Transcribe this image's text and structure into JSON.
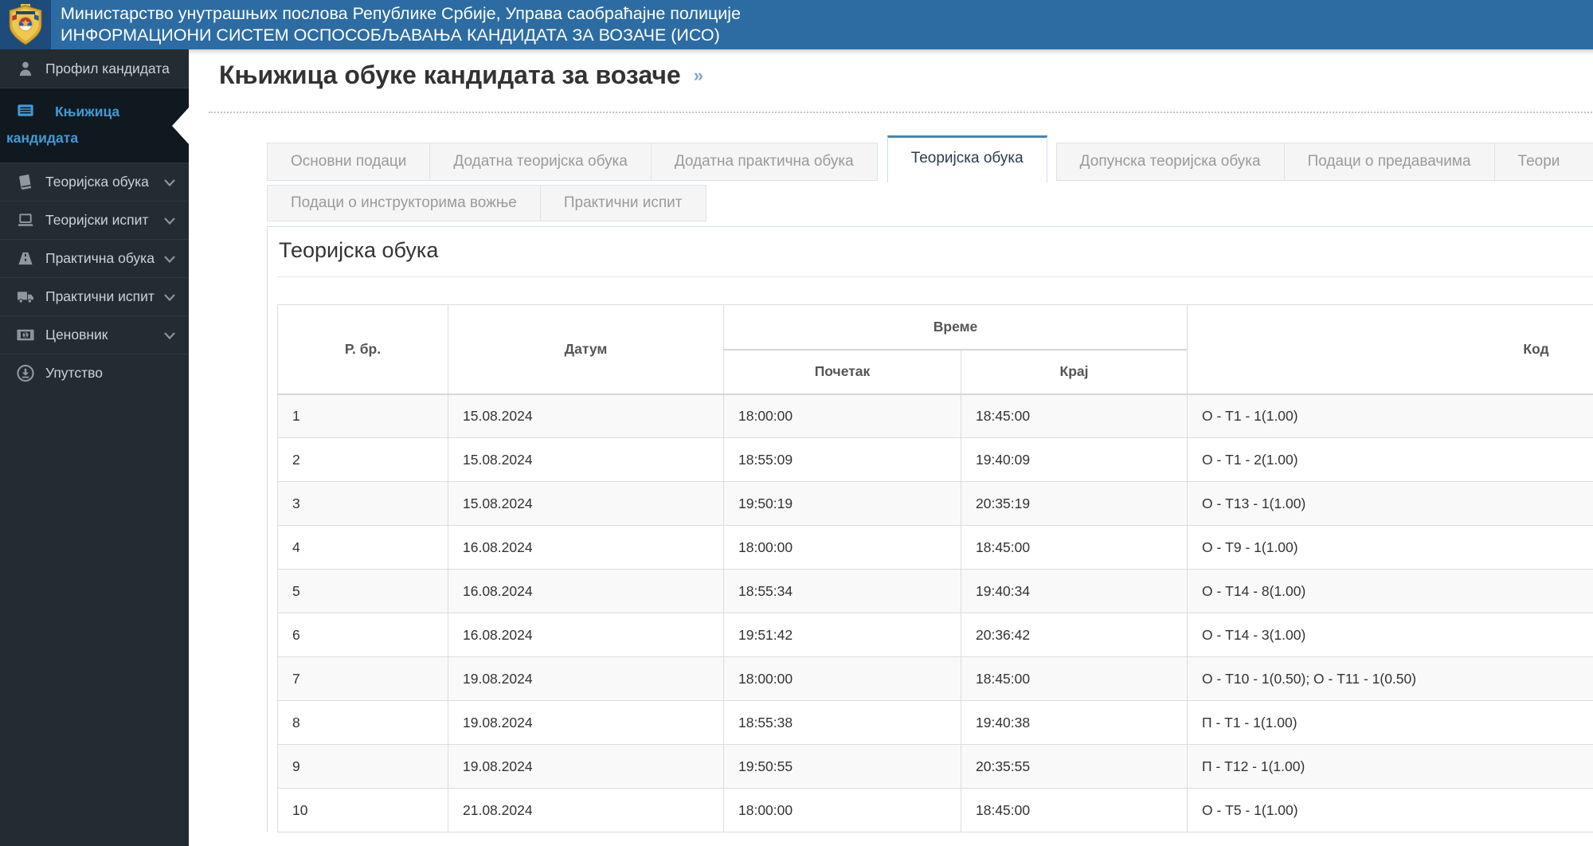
{
  "header": {
    "line1": "Министарство унутрашњих послова Републике Србије, Управа саобраћајне полиције",
    "line2": "ИНФОРМАЦИОНИ СИСТЕМ ОСПОСОБЉАВАЊА КАНДИДАТА ЗА ВОЗАЧЕ (ИСО)"
  },
  "sidebar": {
    "items": [
      {
        "key": "profil-kandidata",
        "label": "Профил кандидата",
        "icon": "user-icon",
        "active": false,
        "chevron": false
      },
      {
        "key": "knjizica-kandidata",
        "label": "Књижица кандидата",
        "icon": "list-icon",
        "active": true,
        "chevron": false
      },
      {
        "key": "teorijska-obuka",
        "label": "Теоријска обука",
        "icon": "book-icon",
        "active": false,
        "chevron": true
      },
      {
        "key": "teorijski-ispit",
        "label": "Теоријски испит",
        "icon": "laptop-icon",
        "active": false,
        "chevron": true
      },
      {
        "key": "prakticna-obuka",
        "label": "Практична обука",
        "icon": "road-icon",
        "active": false,
        "chevron": true
      },
      {
        "key": "prakticni-ispit",
        "label": "Практични испит",
        "icon": "truck-icon",
        "active": false,
        "chevron": true
      },
      {
        "key": "cenovnik",
        "label": "Ценовник",
        "icon": "banknote-icon",
        "active": false,
        "chevron": true
      },
      {
        "key": "uputstvo",
        "label": "Упутство",
        "icon": "download-icon",
        "active": false,
        "chevron": false
      }
    ]
  },
  "page": {
    "title": "Књижица обуке кандидата за возаче",
    "title_suffix": "»"
  },
  "tabs": {
    "row1": [
      {
        "key": "osnovni-podaci",
        "label": "Основни подаци",
        "active": false
      },
      {
        "key": "dodatna-teorijska-obuka",
        "label": "Додатна теоријска обука",
        "active": false
      },
      {
        "key": "dodatna-prakticna-obuka",
        "label": "Додатна практична обука",
        "active": false
      },
      {
        "key": "teorijska-obuka",
        "label": "Теоријска обука",
        "active": true
      },
      {
        "key": "dopunska-teorijska-obuka",
        "label": "Допунска теоријска обука",
        "active": false
      },
      {
        "key": "podaci-o-predavacima",
        "label": "Подаци о предавачима",
        "active": false
      },
      {
        "key": "teori-clipped",
        "label": "Теори",
        "active": false,
        "clipped": true
      }
    ],
    "row2": [
      {
        "key": "podaci-o-instruktorima-voznje",
        "label": "Подаци о инструкторима вожње",
        "active": false
      },
      {
        "key": "prakticni-ispit",
        "label": "Практични испит",
        "active": false
      }
    ]
  },
  "panel": {
    "heading": "Теоријска обука",
    "table": {
      "columns": {
        "rbr": "Р. бр.",
        "datum": "Датум",
        "vreme": "Време",
        "pocetak": "Почетак",
        "kraj": "Крај",
        "kod": "Код"
      },
      "rows": [
        [
          "1",
          "15.08.2024",
          "18:00:00",
          "18:45:00",
          "О - Т1 - 1(1.00)"
        ],
        [
          "2",
          "15.08.2024",
          "18:55:09",
          "19:40:09",
          "О - Т1 - 2(1.00)"
        ],
        [
          "3",
          "15.08.2024",
          "19:50:19",
          "20:35:19",
          "О - Т13 - 1(1.00)"
        ],
        [
          "4",
          "16.08.2024",
          "18:00:00",
          "18:45:00",
          "О - Т9 - 1(1.00)"
        ],
        [
          "5",
          "16.08.2024",
          "18:55:34",
          "19:40:34",
          "О - Т14 - 8(1.00)"
        ],
        [
          "6",
          "16.08.2024",
          "19:51:42",
          "20:36:42",
          "О - Т14 - 3(1.00)"
        ],
        [
          "7",
          "19.08.2024",
          "18:00:00",
          "18:45:00",
          "О - Т10 - 1(0.50); О - Т11 - 1(0.50)"
        ],
        [
          "8",
          "19.08.2024",
          "18:55:38",
          "19:40:38",
          "П - Т1 - 1(1.00)"
        ],
        [
          "9",
          "19.08.2024",
          "19:50:55",
          "20:35:55",
          "П - Т12 - 1(1.00)"
        ],
        [
          "10",
          "21.08.2024",
          "18:00:00",
          "18:45:00",
          "О - Т5 - 1(1.00)"
        ]
      ]
    }
  },
  "colors": {
    "header_blue": "#2d6ca3",
    "logo_navy": "#1c4b7c",
    "sidebar_dark": "#232c31",
    "sidebar_active_bg": "#101920",
    "active_link_blue": "#3f9bd8",
    "title_blue": "#2e7ab5",
    "tab_active_top": "#4886b0",
    "stripe_grey": "#f9f9f9"
  }
}
